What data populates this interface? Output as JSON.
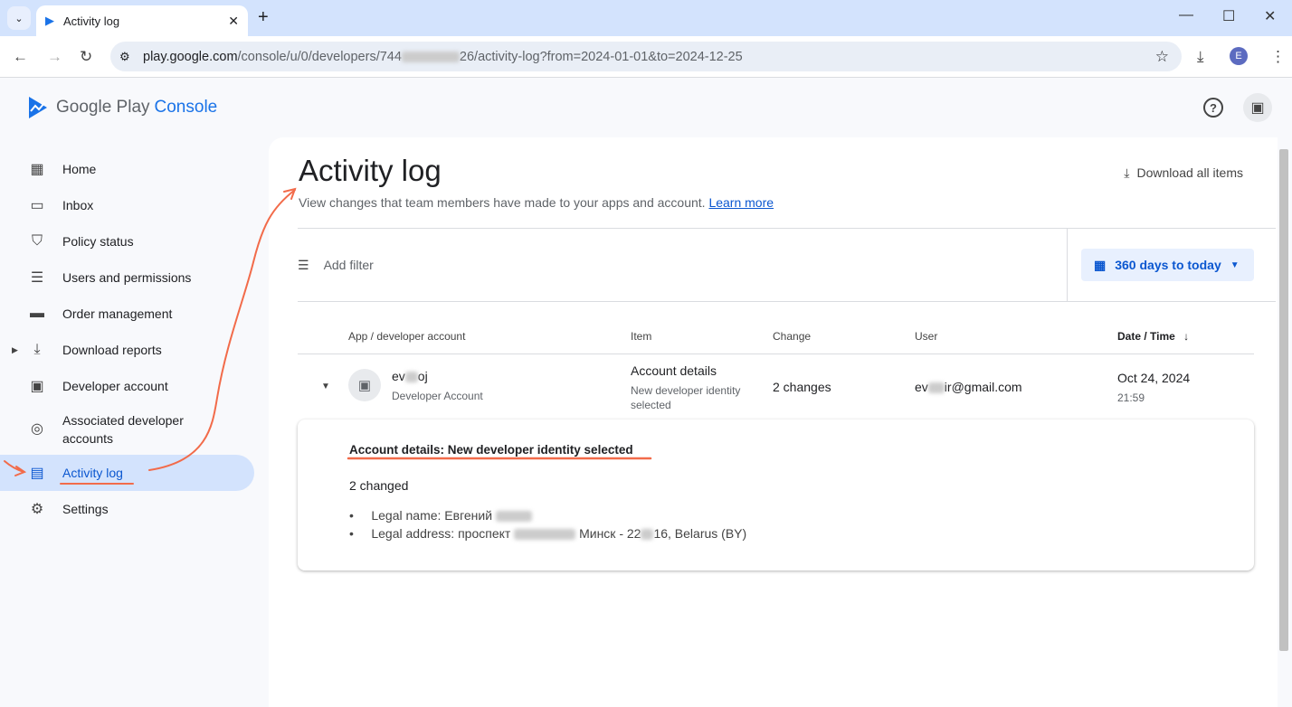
{
  "browser": {
    "tab_title": "Activity log",
    "url_host": "play.google.com",
    "url_path_a": "/console/u/0/developers/744",
    "url_path_b": "26/activity-log?from=2024-01-01&to=2024-12-25",
    "profile_initial": "E"
  },
  "app": {
    "logo_a": "Google Play",
    "logo_b": "Console"
  },
  "sidebar": {
    "items": [
      {
        "label": "Home",
        "icon": "grid-icon",
        "glyph": "▦"
      },
      {
        "label": "Inbox",
        "icon": "inbox-icon",
        "glyph": "▭"
      },
      {
        "label": "Policy status",
        "icon": "shield-icon",
        "glyph": "⛉"
      },
      {
        "label": "Users and permissions",
        "icon": "users-icon",
        "glyph": "☰"
      },
      {
        "label": "Order management",
        "icon": "card-icon",
        "glyph": "▬"
      },
      {
        "label": "Download reports",
        "icon": "download-icon",
        "glyph": "⤓"
      },
      {
        "label": "Developer account",
        "icon": "badge-icon",
        "glyph": "▣"
      },
      {
        "label": "Associated developer accounts",
        "icon": "linked-icon",
        "glyph": "◎"
      },
      {
        "label": "Activity log",
        "icon": "document-icon",
        "glyph": "▤"
      },
      {
        "label": "Settings",
        "icon": "gear-icon",
        "glyph": "⚙"
      }
    ]
  },
  "main": {
    "title": "Activity log",
    "subtitle": "View changes that team members have made to your apps and account.",
    "learn_more": "Learn more",
    "download_all": "Download all items",
    "add_filter": "Add filter",
    "date_range": "360 days to today",
    "columns": [
      "App / developer account",
      "Item",
      "Change",
      "User",
      "Date / Time"
    ],
    "row": {
      "account_a": "ev",
      "account_b": "oj",
      "account_type": "Developer Account",
      "item": "Account details",
      "item_detail": "New developer identity selected",
      "change": "2 changes",
      "user_a": "ev",
      "user_b": "ir@gmail.com",
      "date": "Oct 24, 2024",
      "time": "21:59"
    },
    "details": {
      "heading": "Account details: New developer identity selected",
      "count": "2 changed",
      "line1": "Legal name: Евгений",
      "line2_a": "Legal address: проспект",
      "line2_b": "Минск - 22",
      "line2_c": "16, Belarus (BY)"
    }
  },
  "colors": {
    "accent": "#0b57d0",
    "annotation": "#f26b4a"
  }
}
